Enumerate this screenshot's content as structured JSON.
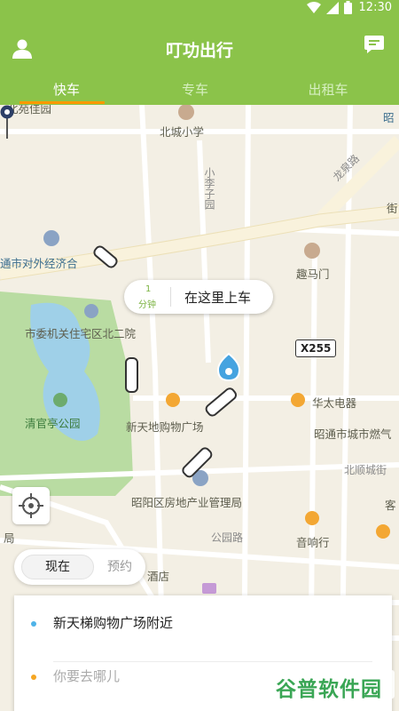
{
  "status_bar": {
    "time": "12:30"
  },
  "header": {
    "title": "叮功出行",
    "tabs": [
      {
        "label": "快车",
        "active": true
      },
      {
        "label": "专车",
        "active": false
      },
      {
        "label": "出租车",
        "active": false
      }
    ]
  },
  "map": {
    "labels": {
      "north_park": "北苑佳园",
      "north_school": "北城小学",
      "xiaoli": "小李子园",
      "economic": "通市对外经济合",
      "qumamen": "趣马门",
      "committee": "市委机关住宅区北二院",
      "qingguanting": "清官亭公园",
      "taihua": "华太电器",
      "xintiandi": "新天地购物广场",
      "zhaotong_city": "昭通市城市燃气",
      "zhaoyang_bureau": "昭阳区房地产业管理局",
      "beishun": "北顺城街",
      "gongyuan": "公园路",
      "yinxiang": "音响行",
      "hotel": "酒店",
      "ju": "局",
      "long_quan": "龙泉路",
      "zhao_edge": "昭",
      "jie_right": "街",
      "ke": "客"
    },
    "road_sign": "X255",
    "accent": "#8bc34a",
    "tab_indicator": "#ff9800"
  },
  "pickup": {
    "minutes": "1",
    "unit": "分钟",
    "text": "在这里上车"
  },
  "time_toggle": {
    "now": "现在",
    "later": "预约"
  },
  "addresses": {
    "from": {
      "text": "新天梯购物广场附近",
      "dot_color": "#4fb3e8"
    },
    "to": {
      "placeholder": "你要去哪儿",
      "dot_color": "#f5a623"
    }
  },
  "watermark": {
    "text": "谷普软件园"
  }
}
